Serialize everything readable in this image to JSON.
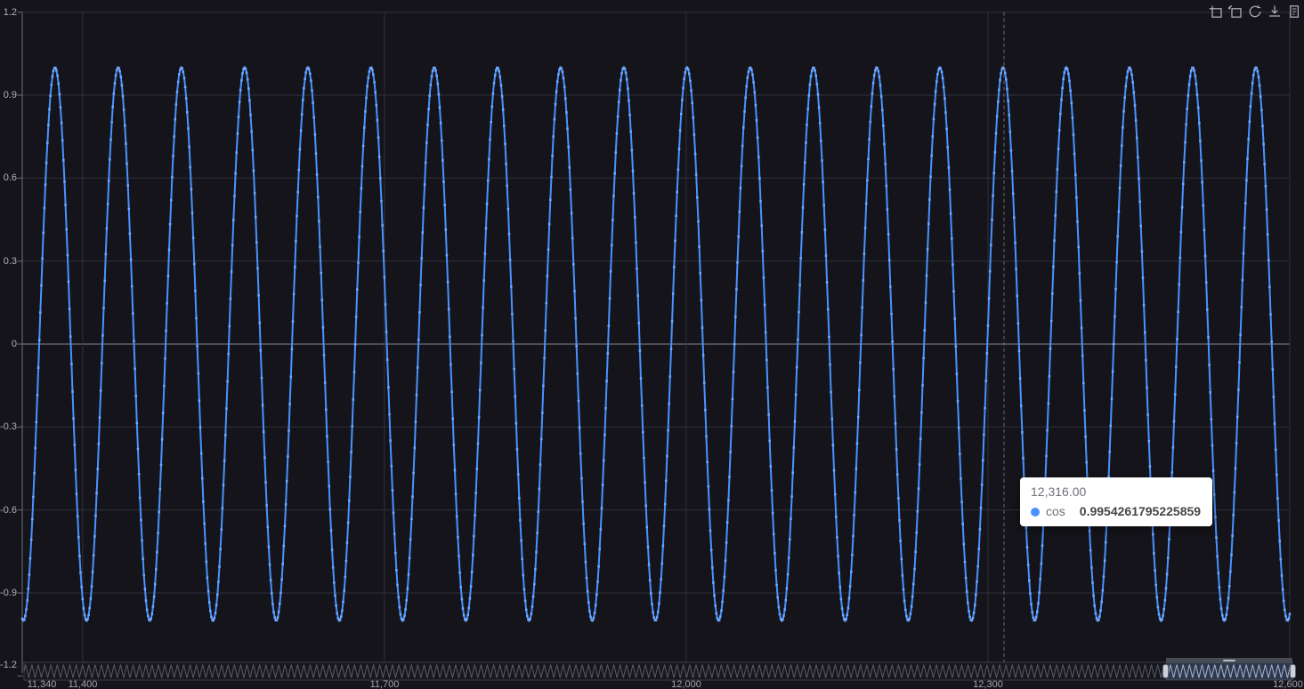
{
  "page": {
    "background": "#14141a"
  },
  "toolbar": {
    "icons": [
      {
        "name": "area-zoom-icon",
        "label": "area zoom"
      },
      {
        "name": "zoom-reset-icon",
        "label": "zoom reset"
      },
      {
        "name": "restore-icon",
        "label": "restore"
      },
      {
        "name": "save-image-icon",
        "label": "save as image"
      },
      {
        "name": "data-view-icon",
        "label": "data view"
      }
    ]
  },
  "tooltip": {
    "x_label": "12,316.00",
    "series": "cos",
    "value": "0.9954261795225859",
    "marker_color": "#4992ff"
  },
  "chart_data": {
    "type": "line",
    "title": "",
    "series": [
      {
        "name": "cos",
        "expression": "y = cos(x / 10)",
        "color": "#4992ff",
        "marker_color": "#72a8fe",
        "symbol": "square",
        "symbol_size": 2.6,
        "sample_step": 1
      }
    ],
    "x_visible_range": [
      11340,
      12600
    ],
    "x_full_range": [
      0,
      12600
    ],
    "ylim": [
      -1.2,
      1.2
    ],
    "x_ticks": [
      {
        "v": 11340,
        "label": "11,340"
      },
      {
        "v": 11400,
        "label": "11,400"
      },
      {
        "v": 11700,
        "label": "11,700"
      },
      {
        "v": 12000,
        "label": "12,000"
      },
      {
        "v": 12300,
        "label": "12,300"
      },
      {
        "v": 12600,
        "label": "12,600"
      }
    ],
    "y_ticks": [
      {
        "v": 1.2,
        "label": "1.2"
      },
      {
        "v": 0.9,
        "label": "0.9"
      },
      {
        "v": 0.6,
        "label": "0.6"
      },
      {
        "v": 0.3,
        "label": "0.3"
      },
      {
        "v": 0,
        "label": "0"
      },
      {
        "v": -0.3,
        "label": "-0.3"
      },
      {
        "v": -0.6,
        "label": "-0.6"
      },
      {
        "v": -0.9,
        "label": "-0.9"
      },
      {
        "v": -1.2,
        "label": "-1.2"
      }
    ],
    "grid": true,
    "legend_visible": false,
    "highlighted_point": {
      "x": 12316,
      "y": 0.9954261795225859
    },
    "axis_pointer": "dashed-vertical",
    "datazoom": {
      "orientation": "horizontal",
      "start_fraction": 0.9,
      "end_fraction": 1.0
    }
  }
}
